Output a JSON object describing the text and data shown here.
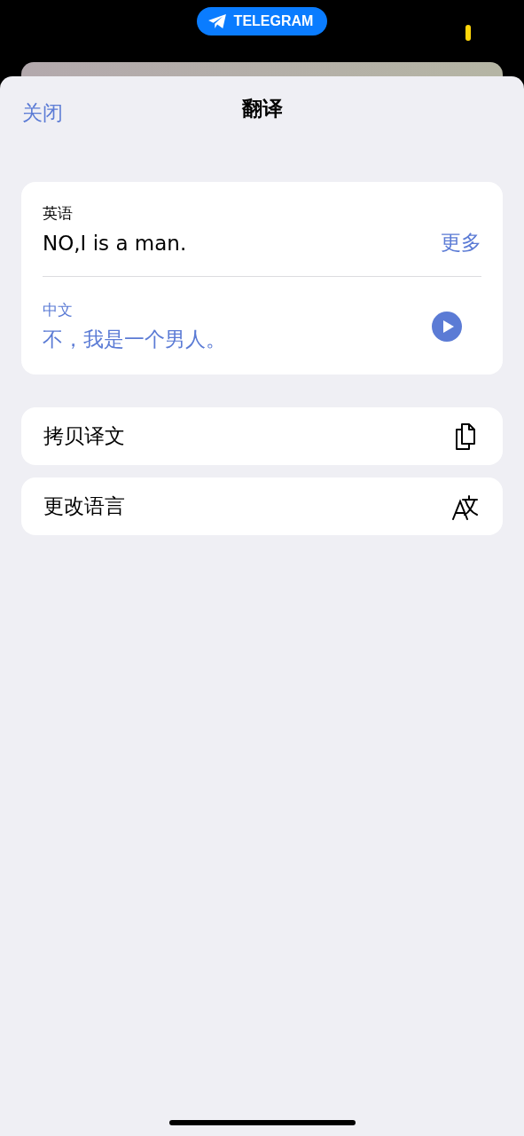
{
  "status_bar": {
    "app_pill": "TELEGRAM"
  },
  "header": {
    "close": "关闭",
    "title": "翻译"
  },
  "translation": {
    "source_language": "英语",
    "source_text": "NO,I is a man.",
    "more": "更多",
    "target_language": "中文",
    "target_text": "不，我是一个男人。"
  },
  "actions": [
    {
      "kind": "copy",
      "label": "拷贝译文"
    },
    {
      "kind": "language",
      "label": "更改语言"
    }
  ]
}
